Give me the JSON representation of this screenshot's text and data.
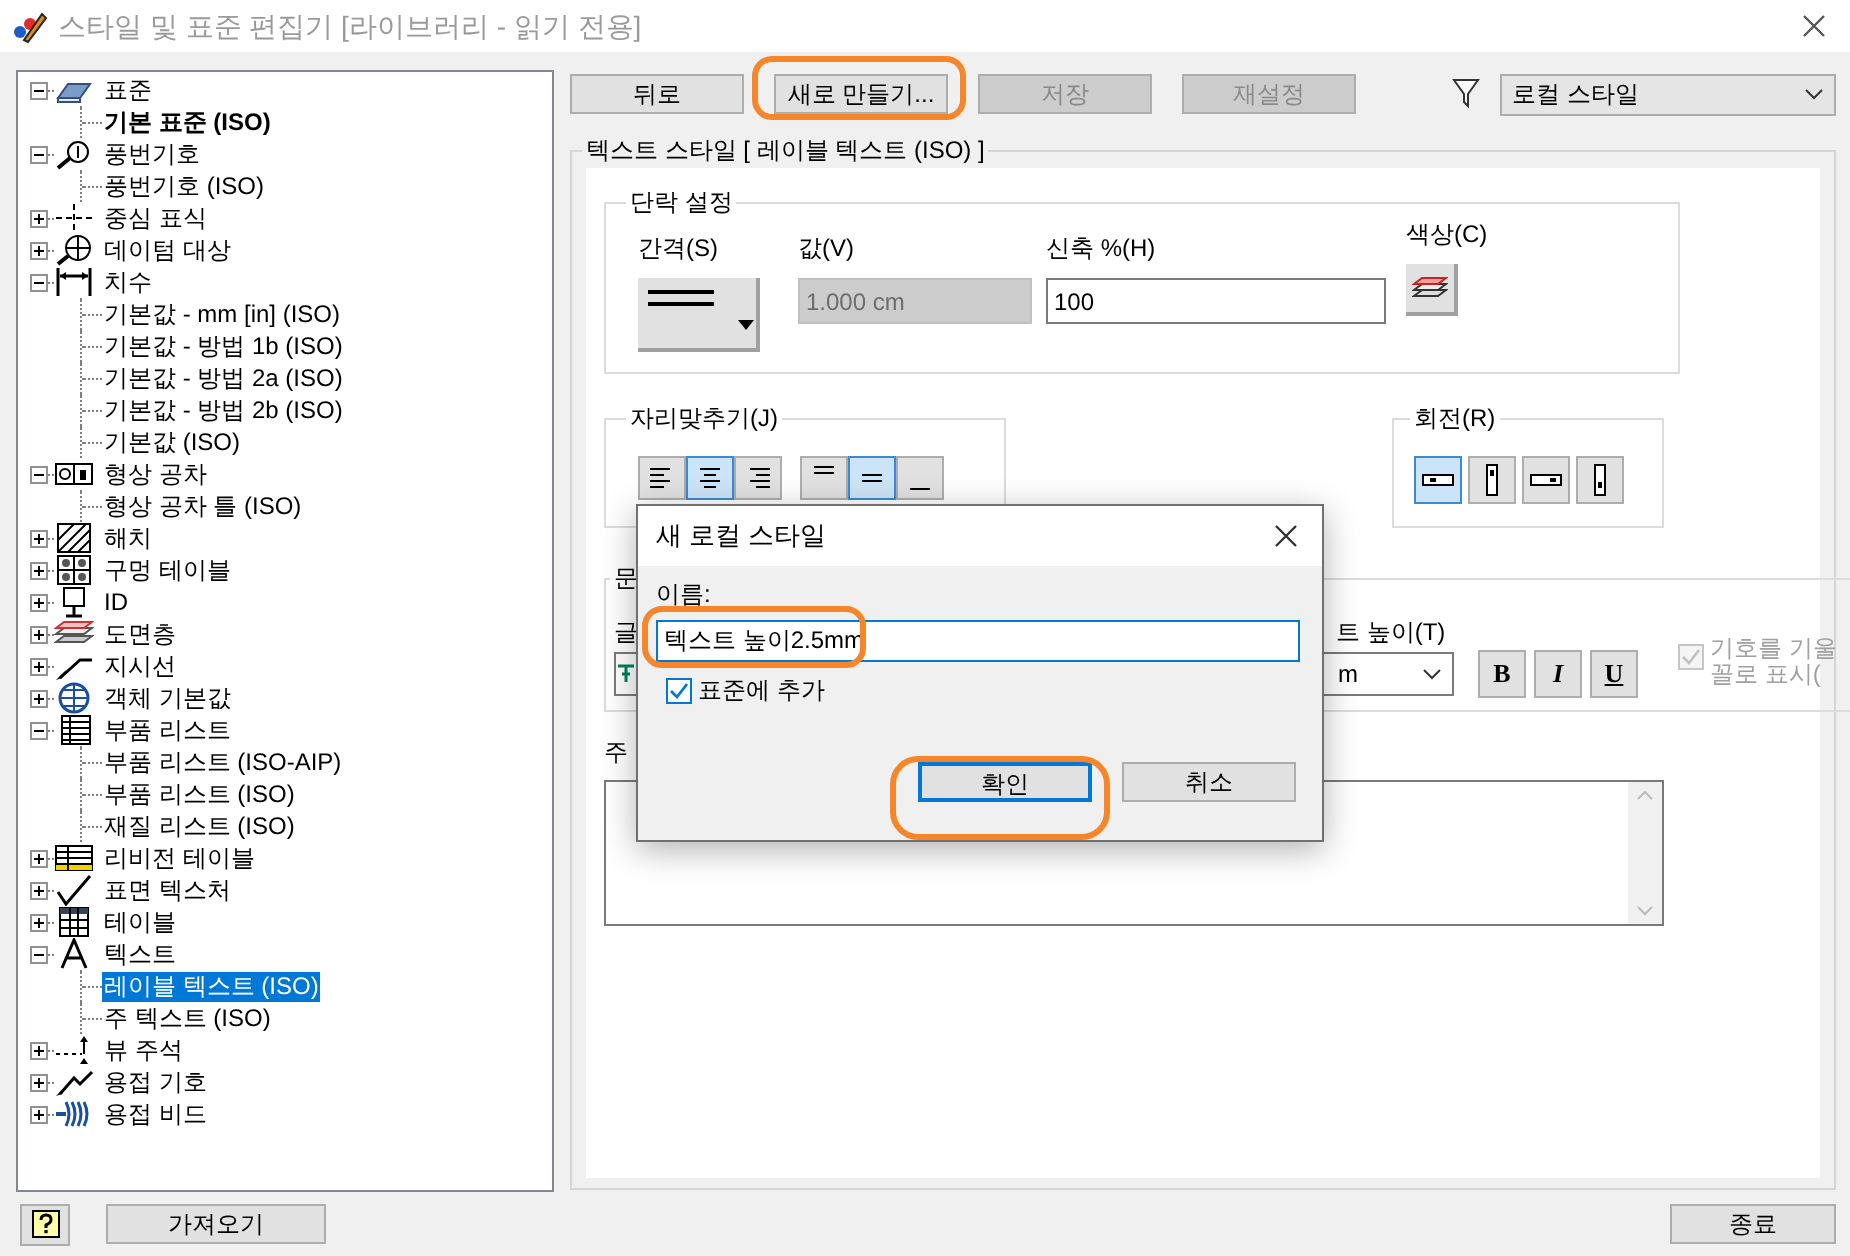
{
  "window": {
    "title": "스타일 및 표준 편집기 [라이브러리 - 읽기 전용]"
  },
  "tree": {
    "items": [
      {
        "label": "표준",
        "kind": "standard",
        "expanded": true,
        "children": [
          {
            "label": "기본 표준 (ISO)",
            "active": true,
            "selected": false
          }
        ]
      },
      {
        "label": "풍번기호",
        "kind": "balloon",
        "expanded": true,
        "children": [
          {
            "label": "풍번기호 (ISO)",
            "active": false,
            "selected": false
          }
        ]
      },
      {
        "label": "중심 표식",
        "kind": "centermark",
        "expanded": false
      },
      {
        "label": "데이텀 대상",
        "kind": "datum",
        "expanded": false
      },
      {
        "label": "치수",
        "kind": "dimension",
        "expanded": true,
        "children": [
          {
            "label": "기본값 - mm [in] (ISO)",
            "active": false,
            "selected": false
          },
          {
            "label": "기본값 - 방법 1b (ISO)",
            "active": false,
            "selected": false
          },
          {
            "label": "기본값 - 방법 2a (ISO)",
            "active": false,
            "selected": false
          },
          {
            "label": "기본값 - 방법 2b (ISO)",
            "active": false,
            "selected": false
          },
          {
            "label": "기본값 (ISO)",
            "active": false,
            "selected": false
          }
        ]
      },
      {
        "label": "형상 공차",
        "kind": "fcf",
        "expanded": true,
        "children": [
          {
            "label": "형상 공차 틀 (ISO)",
            "active": false,
            "selected": false
          }
        ]
      },
      {
        "label": "해치",
        "kind": "hatch",
        "expanded": false
      },
      {
        "label": "구멍 테이블",
        "kind": "holetable",
        "expanded": false
      },
      {
        "label": "ID",
        "kind": "id",
        "expanded": false
      },
      {
        "label": "도면층",
        "kind": "layer",
        "expanded": false
      },
      {
        "label": "지시선",
        "kind": "leader",
        "expanded": false
      },
      {
        "label": "객체 기본값",
        "kind": "globe",
        "expanded": false
      },
      {
        "label": "부품 리스트",
        "kind": "partslist",
        "expanded": true,
        "children": [
          {
            "label": "부품 리스트 (ISO-AIP)",
            "active": false,
            "selected": false
          },
          {
            "label": "부품 리스트 (ISO)",
            "active": false,
            "selected": false
          },
          {
            "label": "재질 리스트 (ISO)",
            "active": false,
            "selected": false
          }
        ]
      },
      {
        "label": "리비전 테이블",
        "kind": "revision",
        "expanded": false
      },
      {
        "label": "표면 텍스처",
        "kind": "surface",
        "expanded": false
      },
      {
        "label": "테이블",
        "kind": "table",
        "expanded": false
      },
      {
        "label": "텍스트",
        "kind": "text",
        "expanded": true,
        "children": [
          {
            "label": "레이블 텍스트 (ISO)",
            "active": false,
            "selected": true
          },
          {
            "label": "주 텍스트 (ISO)",
            "active": false,
            "selected": false
          }
        ]
      },
      {
        "label": "뷰 주석",
        "kind": "viewannotation",
        "expanded": false
      },
      {
        "label": "용접 기호",
        "kind": "weld",
        "expanded": false
      },
      {
        "label": "용접 비드",
        "kind": "bead",
        "expanded": false
      }
    ]
  },
  "toolbar": {
    "buttons": [
      {
        "label": "뒤로",
        "disabled": false
      },
      {
        "label": "새로 만들기...",
        "disabled": false
      },
      {
        "label": "저장",
        "disabled": true
      },
      {
        "label": "재설정",
        "disabled": true
      }
    ],
    "filter": {
      "value": "로컬 스타일"
    }
  },
  "style_group": {
    "title": "텍스트 스타일 [ 레이블 텍스트 (ISO) ]",
    "paragraph": {
      "title": "단락 설정",
      "spacing_label": "간격(S)",
      "value_label": "값(V)",
      "value": "1.000 cm",
      "value_disabled": true,
      "stretch_label": "신축 %(H)",
      "stretch": "100",
      "color_label": "색상(C)"
    },
    "justify": {
      "title": "자리맞추기(J)",
      "buttons": [
        {
          "kind": "left",
          "selected": false
        },
        {
          "kind": "center",
          "selected": true
        },
        {
          "kind": "right",
          "selected": false
        },
        {
          "kind": "top",
          "selected": false
        },
        {
          "kind": "middle",
          "selected": true
        },
        {
          "kind": "bottom",
          "selected": false
        }
      ]
    },
    "rotation": {
      "title": "회전(R)",
      "buttons": [
        {
          "kind": "r0",
          "selected": true
        },
        {
          "kind": "r90",
          "selected": false
        },
        {
          "kind": "r180",
          "selected": false
        },
        {
          "kind": "r270",
          "selected": false
        }
      ]
    },
    "character": {
      "title": "문",
      "font_label": "글",
      "height_label": "트 높이(T)",
      "height_value": "m",
      "styles": [
        {
          "label": "B",
          "selected": false
        },
        {
          "label": "I",
          "selected": false
        },
        {
          "label": "U",
          "selected": false
        }
      ],
      "italic_symbol": {
        "lines": [
          "기호를 기울",
          "꼴로 표시("
        ],
        "checked": true,
        "disabled": true
      }
    },
    "note_label": "주"
  },
  "dialog": {
    "title": "새 로컬 스타일",
    "name_label": "이름:",
    "name_value": "텍스트 높이2.5mm",
    "add_to_standard": {
      "label": "표준에 추가",
      "checked": true
    },
    "ok": "확인",
    "cancel": "취소"
  },
  "bottom": {
    "import": "가져오기",
    "close": "종료"
  }
}
